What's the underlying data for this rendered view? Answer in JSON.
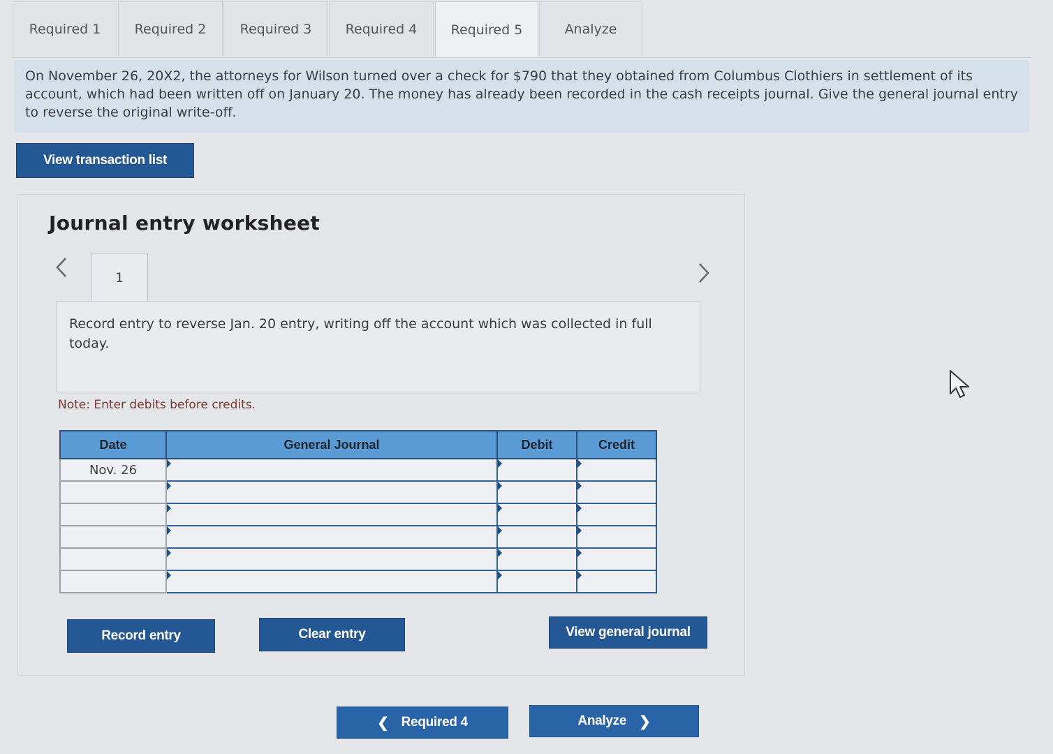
{
  "tabs": [
    {
      "label": "Required 1",
      "active": false
    },
    {
      "label": "Required 2",
      "active": false
    },
    {
      "label": "Required 3",
      "active": false
    },
    {
      "label": "Required 4",
      "active": false
    },
    {
      "label": "Required 5",
      "active": true
    },
    {
      "label": "Analyze",
      "active": false
    }
  ],
  "prompt": {
    "text": "On November 26, 20X2, the attorneys for Wilson turned over a check for $790 that they obtained from Columbus Clothiers in settlement of its account, which had been written off on January 20. The money has already been recorded in the cash receipts journal. Give the general journal entry to reverse the original write-off."
  },
  "buttons": {
    "view_transactions": "View transaction list",
    "record_entry": "Record entry",
    "clear_entry": "Clear entry",
    "view_general_journal": "View general journal"
  },
  "worksheet": {
    "title": "Journal entry worksheet",
    "entry_number": "1",
    "description": "Record entry to reverse Jan. 20 entry, writing off the account which was collected in full today.",
    "note": "Note: Enter debits before credits."
  },
  "table": {
    "headers": [
      "Date",
      "General Journal",
      "Debit",
      "Credit"
    ],
    "rows": [
      {
        "date": "Nov. 26",
        "account": "",
        "debit": "",
        "credit": ""
      },
      {
        "date": "",
        "account": "",
        "debit": "",
        "credit": ""
      },
      {
        "date": "",
        "account": "",
        "debit": "",
        "credit": ""
      },
      {
        "date": "",
        "account": "",
        "debit": "",
        "credit": ""
      },
      {
        "date": "",
        "account": "",
        "debit": "",
        "credit": ""
      },
      {
        "date": "",
        "account": "",
        "debit": "",
        "credit": ""
      }
    ]
  },
  "nav": {
    "prev_label": "Required 4",
    "next_label": "Analyze"
  },
  "colors": {
    "button": "#245894",
    "table_header": "#5a9bd6",
    "prompt_bg": "#d4e0ea"
  }
}
